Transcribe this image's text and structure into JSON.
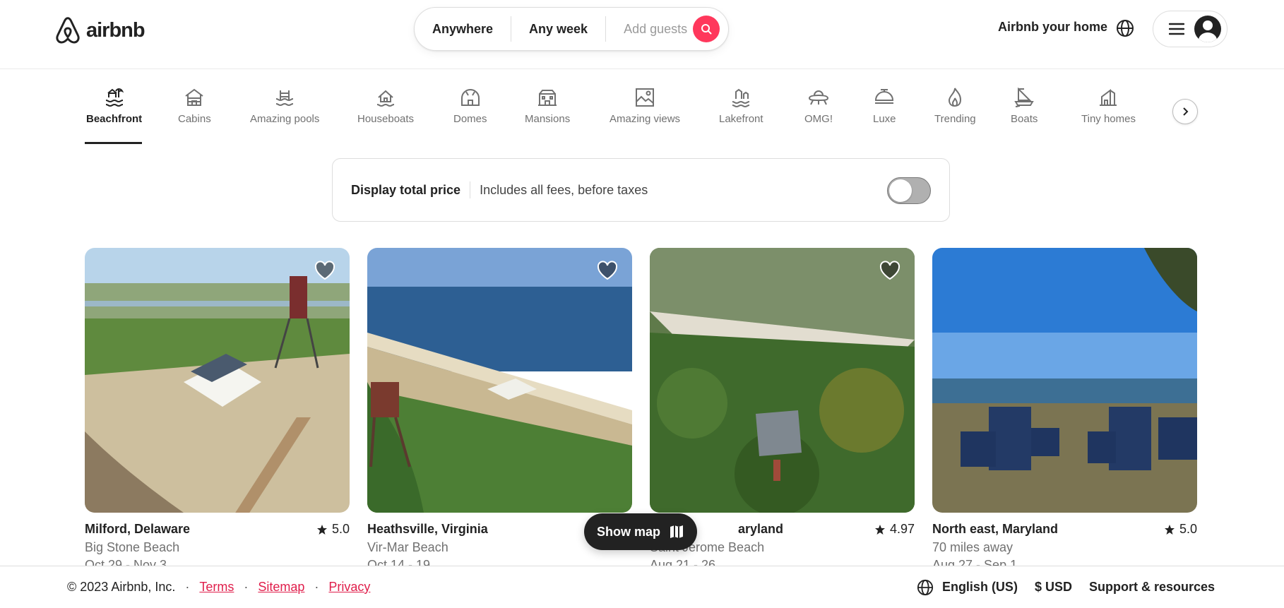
{
  "header": {
    "brand": "airbnb",
    "search": {
      "anywhere": "Anywhere",
      "any_week": "Any week",
      "guests_placeholder": "Add guests"
    },
    "host_link": "Airbnb your home"
  },
  "categories": [
    {
      "label": "Beachfront",
      "icon": "beachfront-icon",
      "active": true
    },
    {
      "label": "Cabins",
      "icon": "cabin-icon"
    },
    {
      "label": "Amazing pools",
      "icon": "pool-icon"
    },
    {
      "label": "Houseboats",
      "icon": "houseboat-icon"
    },
    {
      "label": "Domes",
      "icon": "dome-icon"
    },
    {
      "label": "Mansions",
      "icon": "mansion-icon"
    },
    {
      "label": "Amazing views",
      "icon": "views-icon"
    },
    {
      "label": "Lakefront",
      "icon": "lakefront-icon"
    },
    {
      "label": "OMG!",
      "icon": "ufo-icon"
    },
    {
      "label": "Luxe",
      "icon": "luxe-icon"
    },
    {
      "label": "Trending",
      "icon": "flame-icon"
    },
    {
      "label": "Boats",
      "icon": "boat-icon"
    },
    {
      "label": "Tiny homes",
      "icon": "tiny-home-icon"
    }
  ],
  "price_display": {
    "title": "Display total price",
    "subtitle": "Includes all fees, before taxes",
    "enabled": false
  },
  "listings": [
    {
      "location": "Milford, Delaware",
      "subtitle": "Big Stone Beach",
      "dates": "Oct 29 - Nov 3",
      "rating": "5.0"
    },
    {
      "location": "Heathsville, Virginia",
      "subtitle": "Vir-Mar Beach",
      "dates": "Oct 14 - 19",
      "rating": ""
    },
    {
      "location": "aryland",
      "subtitle": "Saint Jerome Beach",
      "dates": "Aug 21 - 26",
      "rating": "4.97"
    },
    {
      "location": "North east, Maryland",
      "subtitle": "70 miles away",
      "dates": "Aug 27 - Sep 1",
      "rating": "5.0"
    }
  ],
  "show_map": "Show map",
  "footer": {
    "copyright": "© 2023 Airbnb, Inc.",
    "links": [
      "Terms",
      "Sitemap",
      "Privacy"
    ],
    "language": "English (US)",
    "currency": "$ USD",
    "support": "Support & resources"
  },
  "colors": {
    "brand": "#ff385c",
    "footer_link": "#e01e4b"
  }
}
